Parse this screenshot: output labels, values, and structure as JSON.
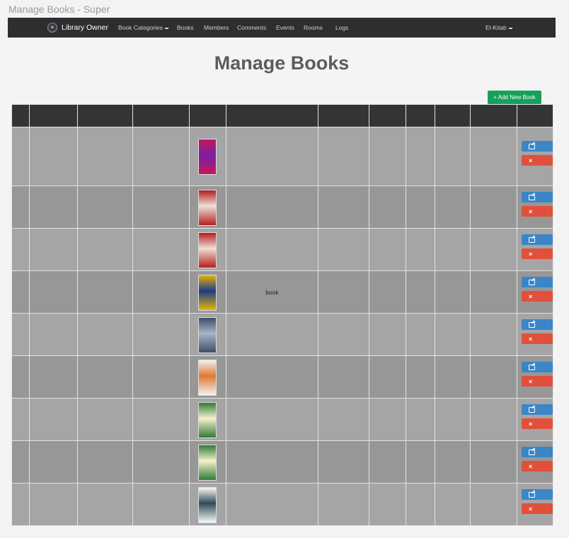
{
  "window": {
    "title": "Manage Books - Super"
  },
  "navbar": {
    "brand": "Library Owner",
    "items": [
      {
        "label": "Book Categories",
        "dropdown": true
      },
      {
        "label": "Books"
      },
      {
        "label": "Members"
      },
      {
        "label": "Comments"
      },
      {
        "label": "Events"
      },
      {
        "label": "Rooms"
      },
      {
        "label": "Logs"
      }
    ],
    "user": {
      "label": "El-Kitab",
      "dropdown": true
    }
  },
  "page": {
    "title": "Manage Books",
    "add_button": "+ Add New Book"
  },
  "table": {
    "headers": [
      "",
      "",
      "",
      "",
      "",
      "",
      "",
      "",
      "",
      "",
      "",
      ""
    ],
    "rows": [
      {
        "cover_colors": [
          "#c2185b",
          "#7b1fa2"
        ],
        "description": ""
      },
      {
        "cover_colors": [
          "#b71c1c",
          "#ece0d8"
        ],
        "description": ""
      },
      {
        "cover_colors": [
          "#b71c1c",
          "#ece0d8"
        ],
        "description": ""
      },
      {
        "cover_colors": [
          "#e3b505",
          "#1e3a8a"
        ],
        "description": "book"
      },
      {
        "cover_colors": [
          "#3c4e6b",
          "#aab3c2"
        ],
        "description": ""
      },
      {
        "cover_colors": [
          "#f2f2f2",
          "#e07a2f"
        ],
        "description": ""
      },
      {
        "cover_colors": [
          "#2e7d32",
          "#f5f0d0"
        ],
        "description": ""
      },
      {
        "cover_colors": [
          "#2e7d32",
          "#f5f0d0"
        ],
        "description": ""
      },
      {
        "cover_colors": [
          "#f8f8f8",
          "#2f4a55"
        ],
        "description": ""
      }
    ],
    "actions": {
      "edit_icon": "edit-icon",
      "delete_icon": "close-icon",
      "delete_glyph": "×"
    }
  },
  "colors": {
    "navbar": "#2c2e30",
    "add_button": "#16a05a",
    "edit": "#3b86c6",
    "delete": "#e0503b"
  }
}
